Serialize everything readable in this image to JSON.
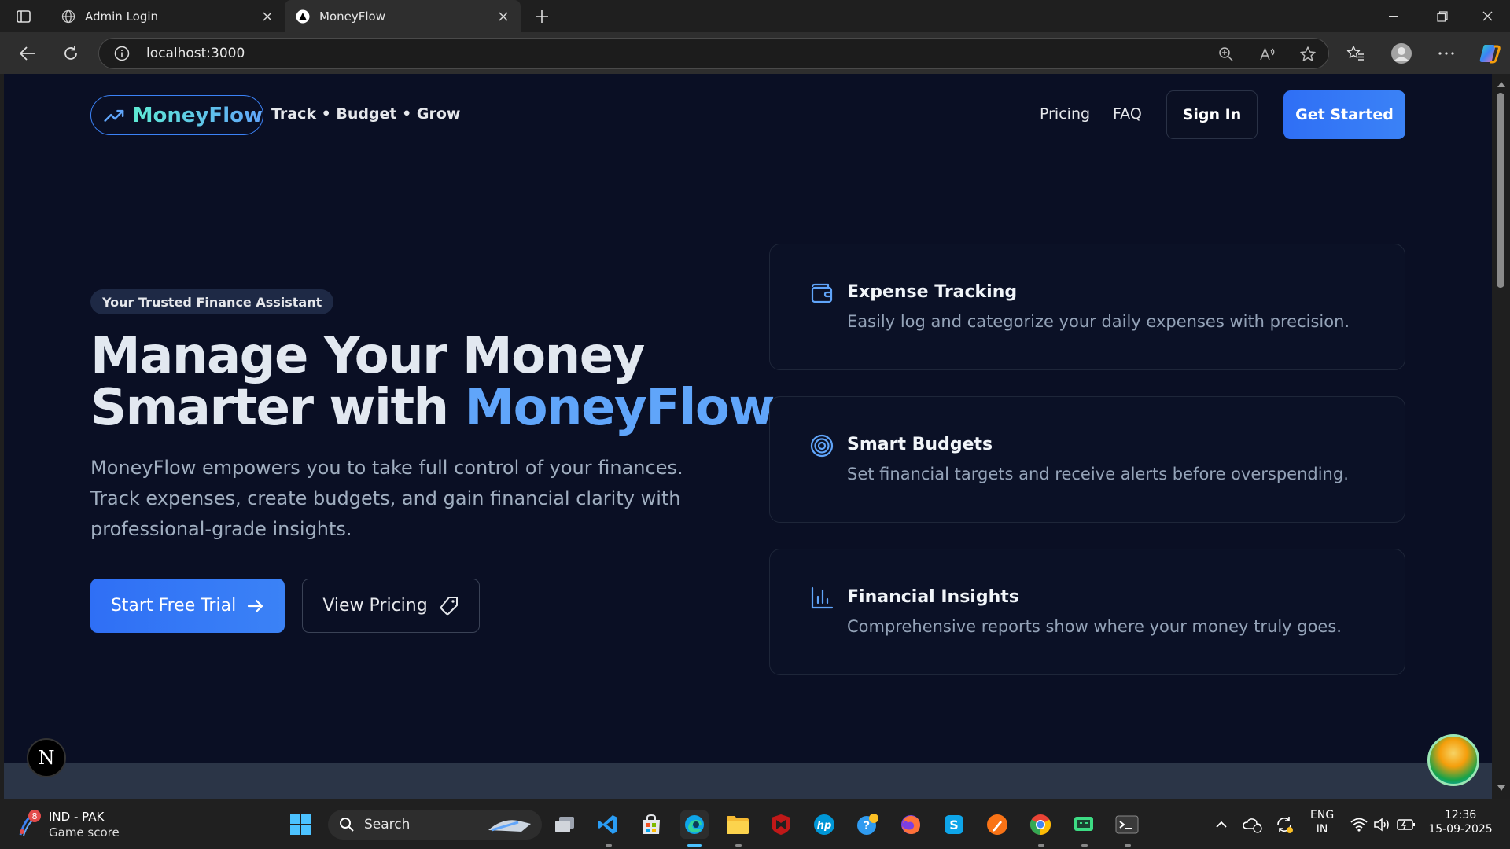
{
  "browser": {
    "tabs": [
      {
        "title": "Admin Login",
        "active": false
      },
      {
        "title": "MoneyFlow",
        "active": true
      }
    ],
    "url": "localhost:3000"
  },
  "site": {
    "logo": "MoneyFlow",
    "tagline": "Track • Budget • Grow",
    "nav": {
      "pricing": "Pricing",
      "faq": "FAQ",
      "sign_in": "Sign In",
      "get_started": "Get Started"
    },
    "hero": {
      "badge": "Your Trusted Finance Assistant",
      "title_line1": "Manage Your Money",
      "title_line2_prefix": "Smarter with",
      "title_accent": "MoneyFlow",
      "description": "MoneyFlow empowers you to take full control of your finances. Track expenses, create budgets, and gain financial clarity with professional-grade insights.",
      "cta_primary": "Start Free Trial",
      "cta_secondary": "View Pricing"
    },
    "features": [
      {
        "title": "Expense Tracking",
        "description": "Easily log and categorize your daily expenses with precision.",
        "icon": "wallet-icon"
      },
      {
        "title": "Smart Budgets",
        "description": "Set financial targets and receive alerts before overspending.",
        "icon": "target-icon"
      },
      {
        "title": "Financial Insights",
        "description": "Comprehensive reports show where your money truly goes.",
        "icon": "bar-chart-icon"
      }
    ],
    "dev_badge": "N",
    "colors": {
      "accent": "#3b82f6",
      "background": "#0a0f24",
      "logo_gradient_start": "#5eead4",
      "logo_gradient_end": "#60a5fa"
    }
  },
  "taskbar": {
    "weather": {
      "badge": "8",
      "title": "IND - PAK",
      "subtitle": "Game score"
    },
    "search_placeholder": "Search",
    "language": {
      "line1": "ENG",
      "line2": "IN"
    },
    "clock": {
      "time": "12:36",
      "date": "15-09-2025"
    }
  }
}
